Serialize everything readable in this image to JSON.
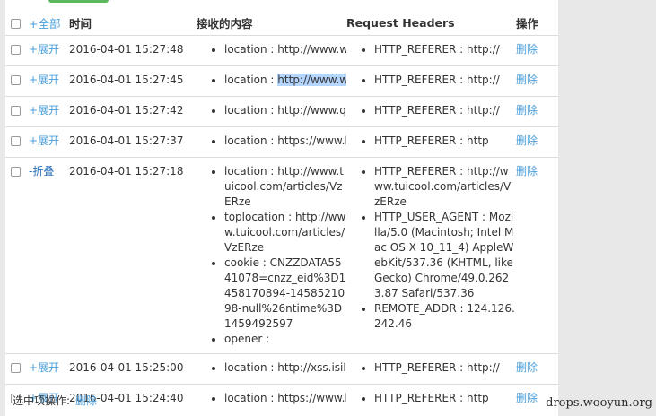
{
  "header": {
    "expand_all": "+全部",
    "time": "时间",
    "content": "接收的内容",
    "headers": "Request Headers",
    "actions": "操作"
  },
  "rows": [
    {
      "toggle": "+展开",
      "time": "2016-04-01 15:27:48",
      "content": [
        "location : http://www.wei"
      ],
      "headers": [
        "HTTP_REFERER : http://"
      ],
      "action": "删除"
    },
    {
      "toggle": "+展开",
      "time": "2016-04-01 15:27:45",
      "content_prefix": "location : ",
      "content_selected": "http://www.wo",
      "headers": [
        "HTTP_REFERER : http://"
      ],
      "action": "删除"
    },
    {
      "toggle": "+展开",
      "time": "2016-04-01 15:27:42",
      "content": [
        "location : http://www.qq."
      ],
      "headers": [
        "HTTP_REFERER : http://"
      ],
      "action": "删除"
    },
    {
      "toggle": "+展开",
      "time": "2016-04-01 15:27:37",
      "content": [
        "location : https://www.ba"
      ],
      "headers": [
        "HTTP_REFERER : http"
      ],
      "action": "删除"
    },
    {
      "toggle": "-折叠",
      "time": "2016-04-01 15:27:18",
      "content": [
        "location : http://www.tuicool.com/articles/VzERze",
        "toplocation : http://www.tuicool.com/articles/VzERze",
        "cookie : CNZZDATA5541078=cnzz_eid%3D1458170894-1458521098-null%26ntime%3D1459492597",
        "opener :"
      ],
      "headers": [
        "HTTP_REFERER : http://www.tuicool.com/articles/VzERze",
        "HTTP_USER_AGENT : Mozilla/5.0 (Macintosh; Intel Mac OS X 10_11_4) AppleWebKit/537.36 (KHTML, like Gecko) Chrome/49.0.2623.87 Safari/537.36",
        "REMOTE_ADDR : 124.126.242.46"
      ],
      "action": "删除"
    },
    {
      "toggle": "+展开",
      "time": "2016-04-01 15:25:00",
      "content": [
        "location : http://xss.isilic."
      ],
      "headers": [
        "HTTP_REFERER : http://"
      ],
      "action": "删除"
    },
    {
      "toggle": "+展开",
      "time": "2016-04-01 15:24:40",
      "content": [
        "location : https://www.ba"
      ],
      "headers": [
        "HTTP_REFERER : http"
      ],
      "action": "删除"
    }
  ],
  "footer": {
    "label": "选中项操作:",
    "delete": "删除"
  },
  "watermark": "drops.wooyun.org"
}
